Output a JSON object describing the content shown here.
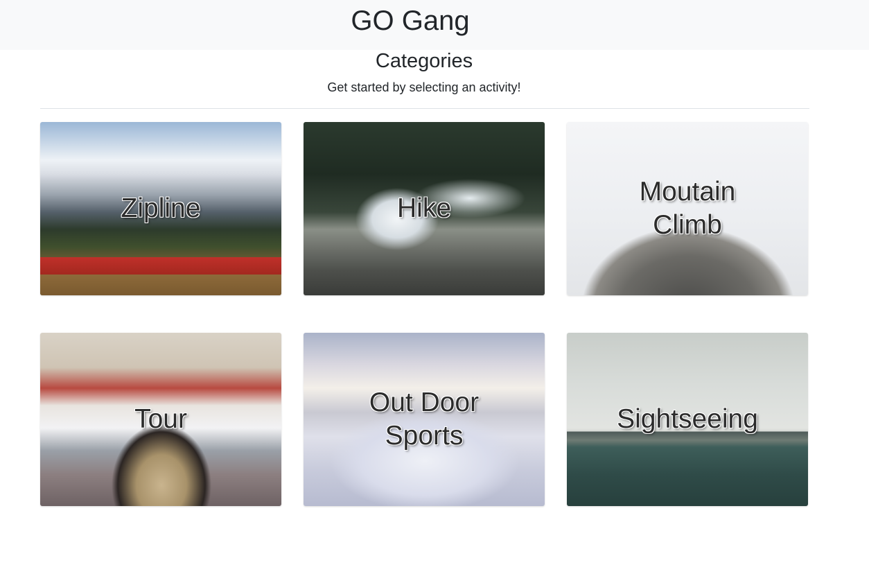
{
  "navbar": {
    "brand": "GO Gang"
  },
  "page": {
    "heading": "Categories",
    "subheading": "Get started by selecting an activity!"
  },
  "categories": [
    {
      "lines": [
        "Zipline"
      ]
    },
    {
      "lines": [
        "Hike"
      ]
    },
    {
      "lines": [
        "Moutain",
        "Climb"
      ]
    },
    {
      "lines": [
        "Tour"
      ]
    },
    {
      "lines": [
        "Out Door",
        "Sports"
      ]
    },
    {
      "lines": [
        "Sightseeing"
      ]
    }
  ]
}
